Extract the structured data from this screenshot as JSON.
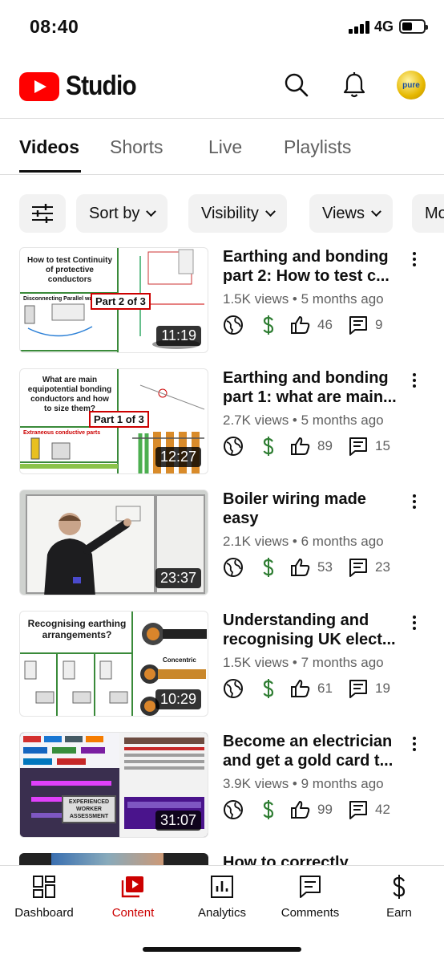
{
  "status_bar": {
    "time": "08:40",
    "network": "4G"
  },
  "header": {
    "logo_text": "Studio",
    "avatar_text": "pure"
  },
  "tabs": [
    {
      "label": "Videos",
      "active": true
    },
    {
      "label": "Shorts",
      "active": false
    },
    {
      "label": "Live",
      "active": false
    },
    {
      "label": "Playlists",
      "active": false
    }
  ],
  "filters": {
    "chips": [
      {
        "label": "Sort by"
      },
      {
        "label": "Visibility"
      },
      {
        "label": "Views"
      },
      {
        "label": "Mo"
      }
    ]
  },
  "videos": [
    {
      "title": "Earthing and bonding part 2: How to test c...",
      "views": "1.5K views",
      "age": "5 months ago",
      "likes": "46",
      "comments": "9",
      "duration": "11:19",
      "thumb_title": "How to test Continuity of protective conductors",
      "thumb_badge": "Part 2 of 3",
      "thumb_caption": "Disconnecting Parallel ways"
    },
    {
      "title": "Earthing and bonding part 1: what are main...",
      "views": "2.7K views",
      "age": "5 months ago",
      "likes": "89",
      "comments": "15",
      "duration": "12:27",
      "thumb_title": "What are main equipotential bonding conductors and how to size them?",
      "thumb_badge": "Part 1 of 3",
      "thumb_caption": "Extraneous conductive parts"
    },
    {
      "title": "Boiler wiring made easy",
      "views": "2.1K views",
      "age": "6 months ago",
      "likes": "53",
      "comments": "23",
      "duration": "23:37"
    },
    {
      "title": "Understanding and recognising UK elect...",
      "views": "1.5K views",
      "age": "7 months ago",
      "likes": "61",
      "comments": "19",
      "duration": "10:29",
      "thumb_title": "Recognising earthing arrangements?",
      "thumb_caption": "Concentric"
    },
    {
      "title": "Become an electrician and get a gold card t...",
      "views": "3.9K views",
      "age": "9 months ago",
      "likes": "99",
      "comments": "42",
      "duration": "31:07",
      "thumb_title": "EXPERIENCED WORKER ASSESSMENT"
    },
    {
      "title": "How to correctly"
    }
  ],
  "bottom_nav": [
    {
      "label": "Dashboard",
      "icon": "dashboard-icon",
      "active": false
    },
    {
      "label": "Content",
      "icon": "content-icon",
      "active": true
    },
    {
      "label": "Analytics",
      "icon": "analytics-icon",
      "active": false
    },
    {
      "label": "Comments",
      "icon": "comments-icon",
      "active": false
    },
    {
      "label": "Earn",
      "icon": "earn-icon",
      "active": false
    }
  ],
  "colors": {
    "brand_red": "#ff0000",
    "active_nav": "#cc0000",
    "money_green": "#2e7d32"
  }
}
